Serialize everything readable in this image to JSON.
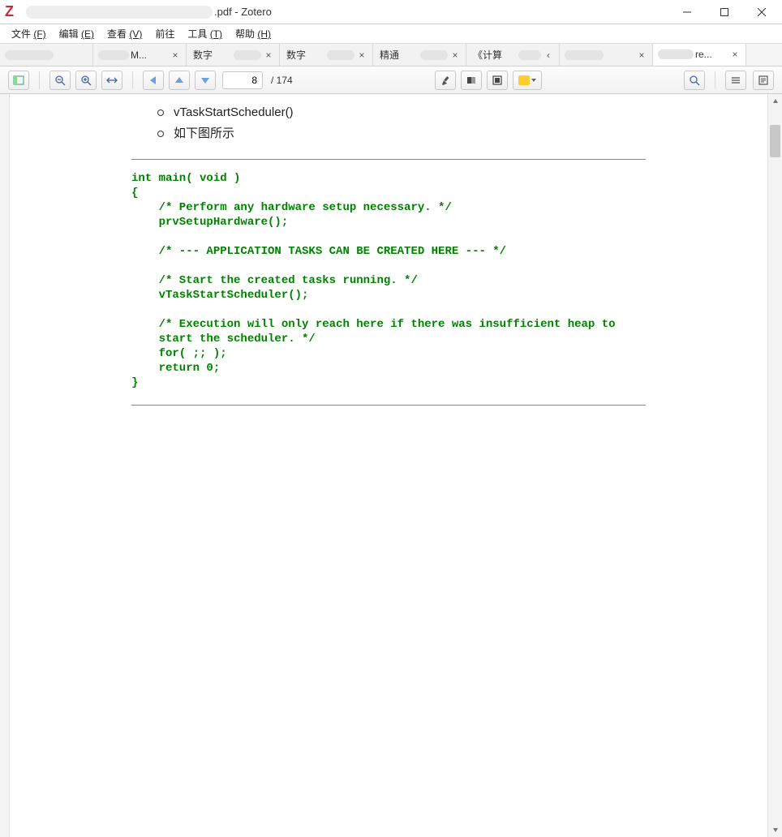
{
  "titlebar": {
    "suffix": ".pdf - Zotero"
  },
  "menu": {
    "file": {
      "label": "文件 ",
      "hotkey": "(F)"
    },
    "edit": {
      "label": "编辑 ",
      "hotkey": "(E)"
    },
    "view": {
      "label": "查看 ",
      "hotkey": "(V)"
    },
    "go": {
      "label": "前往"
    },
    "tools": {
      "label": "工具 ",
      "hotkey": "(T)"
    },
    "help": {
      "label": "帮助 ",
      "hotkey": "(H)"
    }
  },
  "tabs": [
    {
      "label": ""
    },
    {
      "label": "M...",
      "closable": true
    },
    {
      "label": "数字",
      "closable": true
    },
    {
      "label": "数字",
      "closable": true
    },
    {
      "label": "精通",
      "closable": true
    },
    {
      "label": "《计算",
      "closable": true
    },
    {
      "label": "",
      "closable": true
    },
    {
      "label": "re...",
      "closable": true,
      "active": true
    }
  ],
  "toolbar": {
    "page_current": "8",
    "page_total": "/ 174",
    "highlight_color": "#ffcc33"
  },
  "doc": {
    "bullets": [
      "vTaskStartScheduler()",
      "如下图所示"
    ],
    "code": "int main( void )\n{\n    /* Perform any hardware setup necessary. */\n    prvSetupHardware();\n\n    /* --- APPLICATION TASKS CAN BE CREATED HERE --- */\n\n    /* Start the created tasks running. */\n    vTaskStartScheduler();\n\n    /* Execution will only reach here if there was insufficient heap to\n    start the scheduler. */\n    for( ;; );\n    return 0;\n}"
  }
}
